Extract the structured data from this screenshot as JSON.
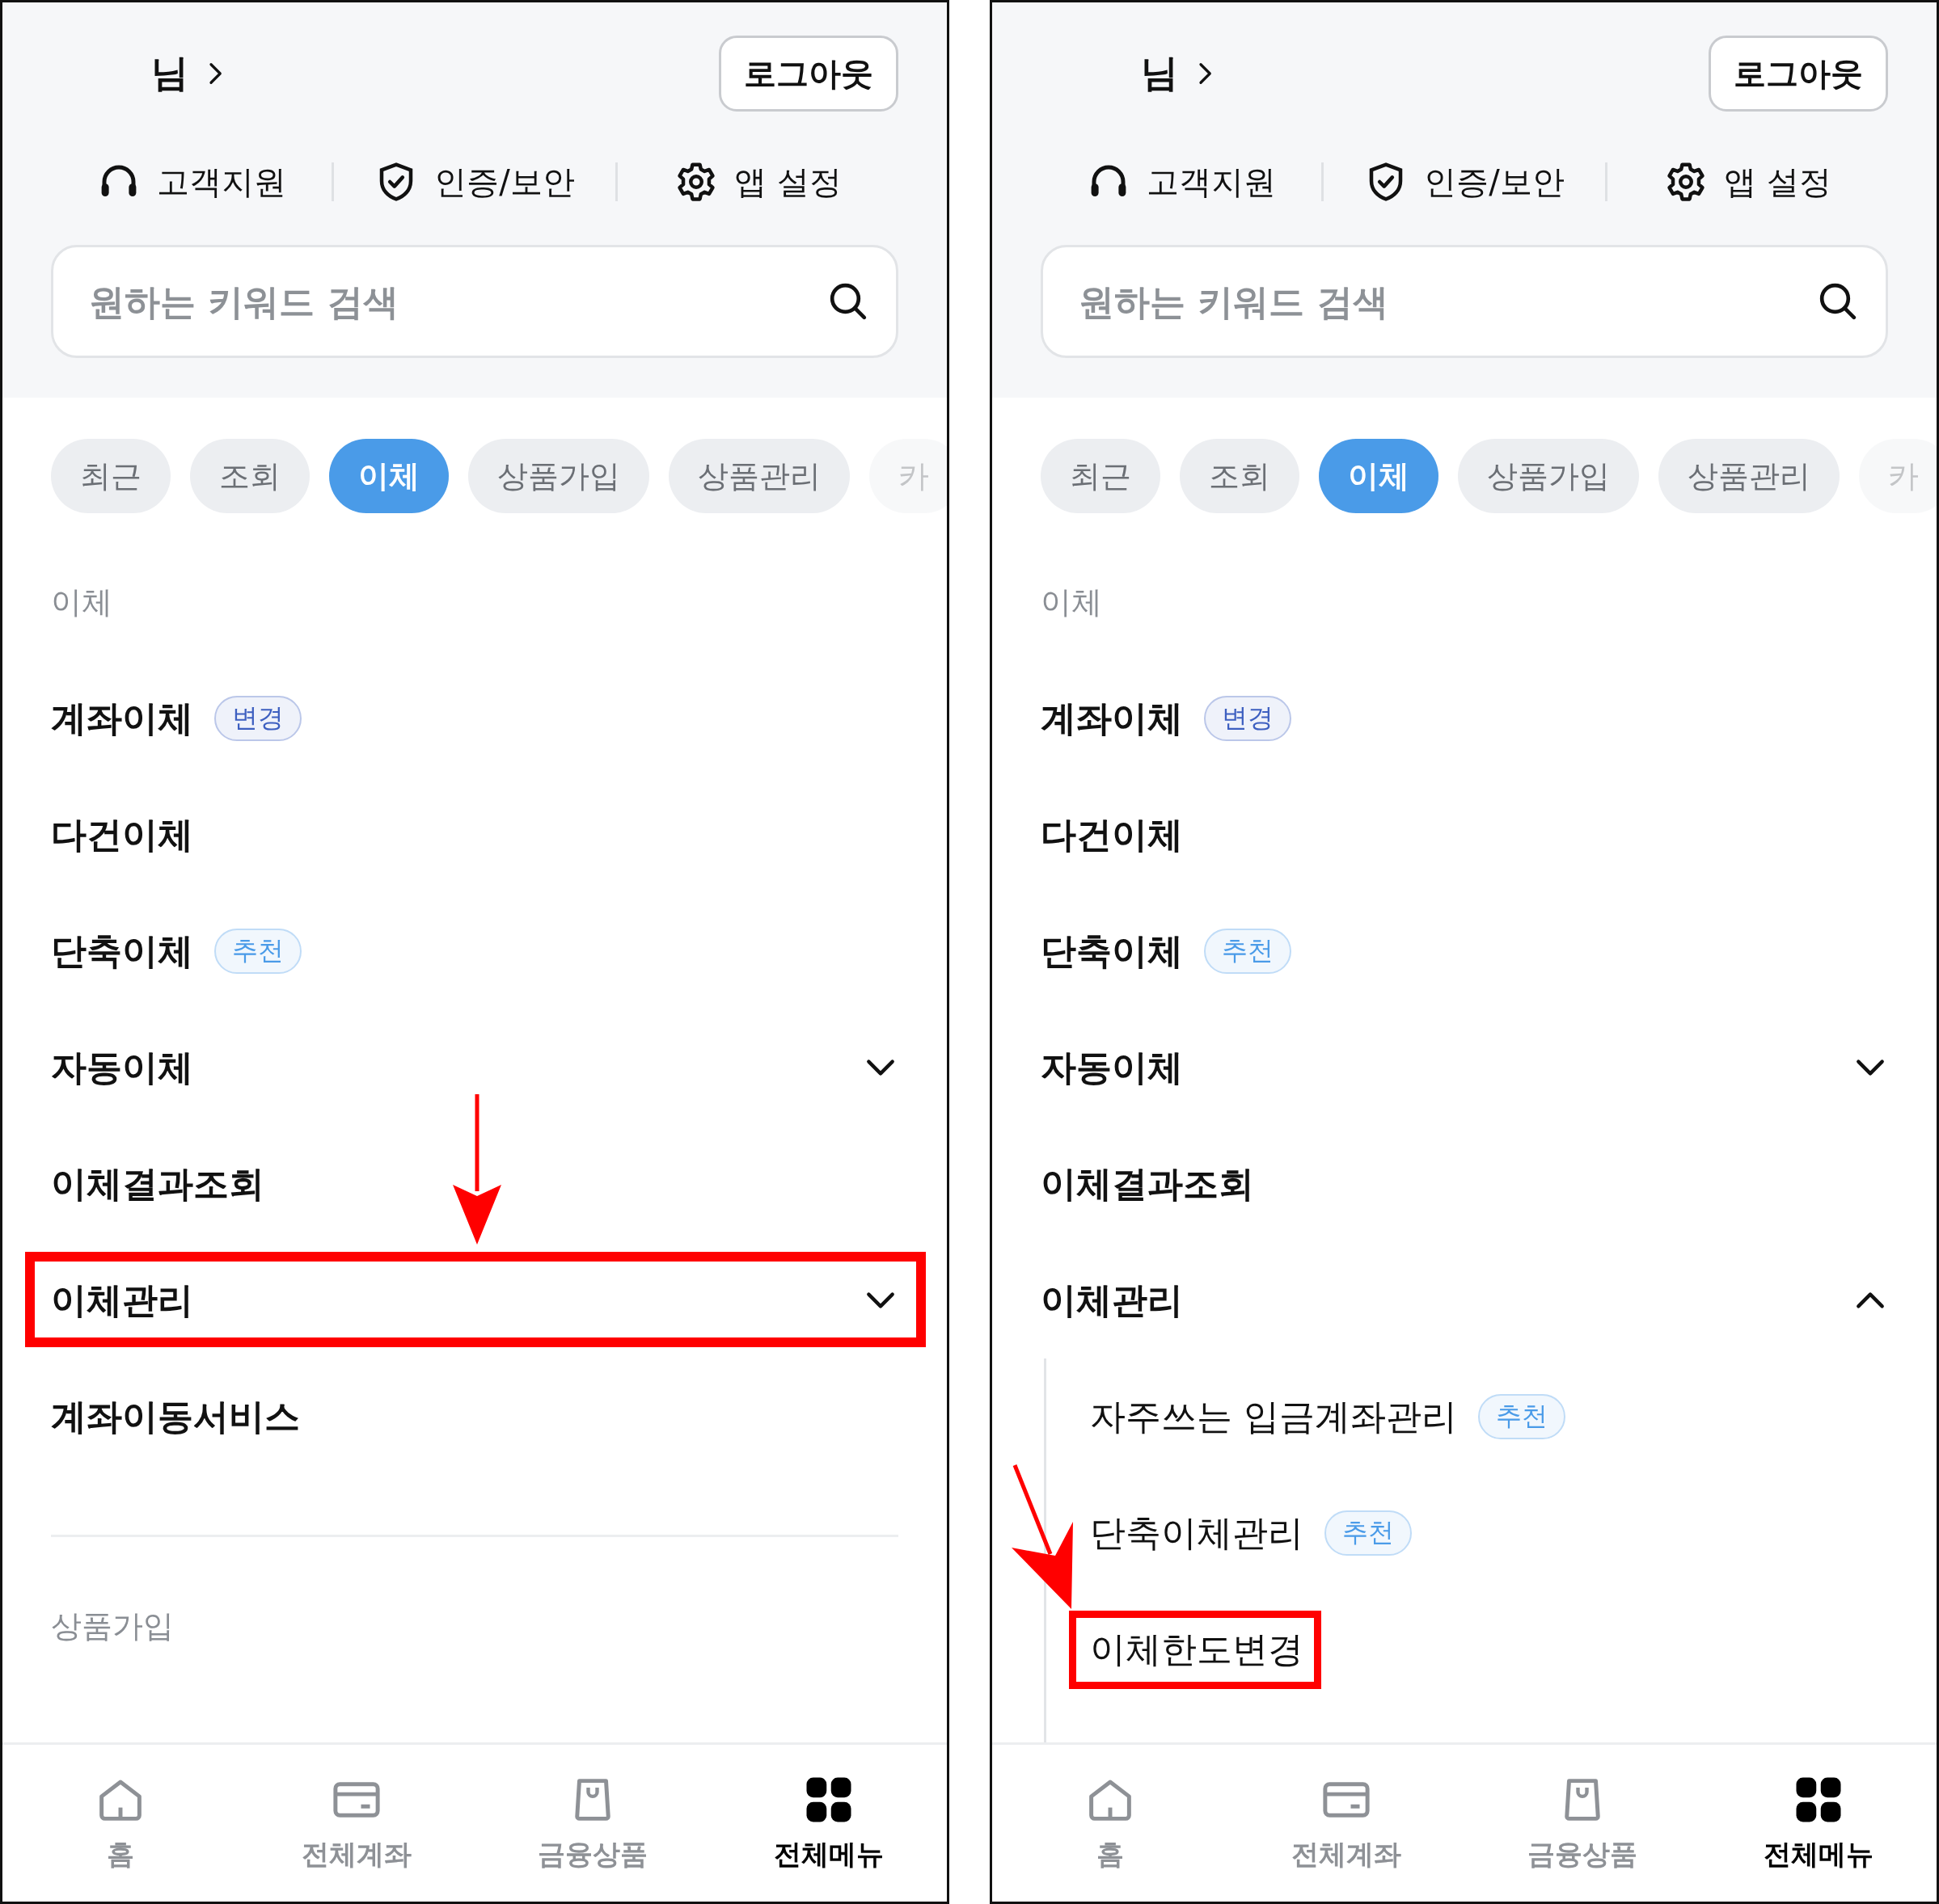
{
  "panels": [
    {
      "user": {
        "suffix": "님"
      },
      "logout": "로그아웃",
      "shortcuts": [
        {
          "kind": "support",
          "label": "고객지원"
        },
        {
          "kind": "security",
          "label": "인증/보안"
        },
        {
          "kind": "settings",
          "label": "앱 설정"
        }
      ],
      "search": {
        "placeholder": "원하는 키워드 검색"
      },
      "chips": [
        {
          "label": "최근",
          "selected": false
        },
        {
          "label": "조회",
          "selected": false
        },
        {
          "label": "이체",
          "selected": true
        },
        {
          "label": "상품가입",
          "selected": false
        },
        {
          "label": "상품관리",
          "selected": false
        },
        {
          "label": "카",
          "selected": false
        }
      ],
      "sections": [
        {
          "title": "이체",
          "items": [
            {
              "label": "계좌이체",
              "badge": {
                "text": "변경",
                "color": "#3d5fc0"
              }
            },
            {
              "label": "다건이체"
            },
            {
              "label": "단축이체",
              "badge": {
                "text": "추천",
                "color": "#4a9be8"
              }
            },
            {
              "label": "자동이체",
              "expanded": false
            },
            {
              "label": "이체결과조회"
            },
            {
              "label": "이체관리",
              "expanded": false,
              "highlight": {
                "kind": "down"
              }
            },
            {
              "label": "계좌이동서비스"
            }
          ]
        },
        {
          "title": "상품가입"
        }
      ],
      "nav": [
        {
          "kind": "home",
          "label": "홈",
          "selected": false
        },
        {
          "kind": "card",
          "label": "전체계좌",
          "selected": false
        },
        {
          "kind": "bag",
          "label": "금융상품",
          "selected": false
        },
        {
          "kind": "grid",
          "label": "전체메뉴",
          "selected": true
        }
      ]
    },
    {
      "user": {
        "suffix": "님"
      },
      "logout": "로그아웃",
      "shortcuts": [
        {
          "kind": "support",
          "label": "고객지원"
        },
        {
          "kind": "security",
          "label": "인증/보안"
        },
        {
          "kind": "settings",
          "label": "앱 설정"
        }
      ],
      "search": {
        "placeholder": "원하는 키워드 검색"
      },
      "chips": [
        {
          "label": "최근",
          "selected": false
        },
        {
          "label": "조회",
          "selected": false
        },
        {
          "label": "이체",
          "selected": true
        },
        {
          "label": "상품가입",
          "selected": false
        },
        {
          "label": "상품관리",
          "selected": false
        },
        {
          "label": "카",
          "selected": false
        }
      ],
      "sections": [
        {
          "title": "이체",
          "items": [
            {
              "label": "계좌이체",
              "badge": {
                "text": "변경",
                "color": "#3d5fc0"
              }
            },
            {
              "label": "다건이체"
            },
            {
              "label": "단축이체",
              "badge": {
                "text": "추천",
                "color": "#4a9be8"
              }
            },
            {
              "label": "자동이체",
              "expanded": false
            },
            {
              "label": "이체결과조회"
            },
            {
              "label": "이체관리",
              "expanded": true,
              "children": [
                {
                  "label": "자주쓰는 입금계좌관리",
                  "badge": {
                    "text": "추천",
                    "color": "#4a9be8"
                  }
                },
                {
                  "label": "단축이체관리",
                  "badge": {
                    "text": "추천",
                    "color": "#4a9be8"
                  }
                },
                {
                  "label": "이체한도변경",
                  "highlight": {
                    "kind": "diagonal"
                  }
                }
              ]
            }
          ]
        }
      ],
      "nav": [
        {
          "kind": "home",
          "label": "홈",
          "selected": false
        },
        {
          "kind": "card",
          "label": "전체계좌",
          "selected": false
        },
        {
          "kind": "bag",
          "label": "금융상품",
          "selected": false
        },
        {
          "kind": "grid",
          "label": "전체메뉴",
          "selected": true
        }
      ]
    }
  ]
}
